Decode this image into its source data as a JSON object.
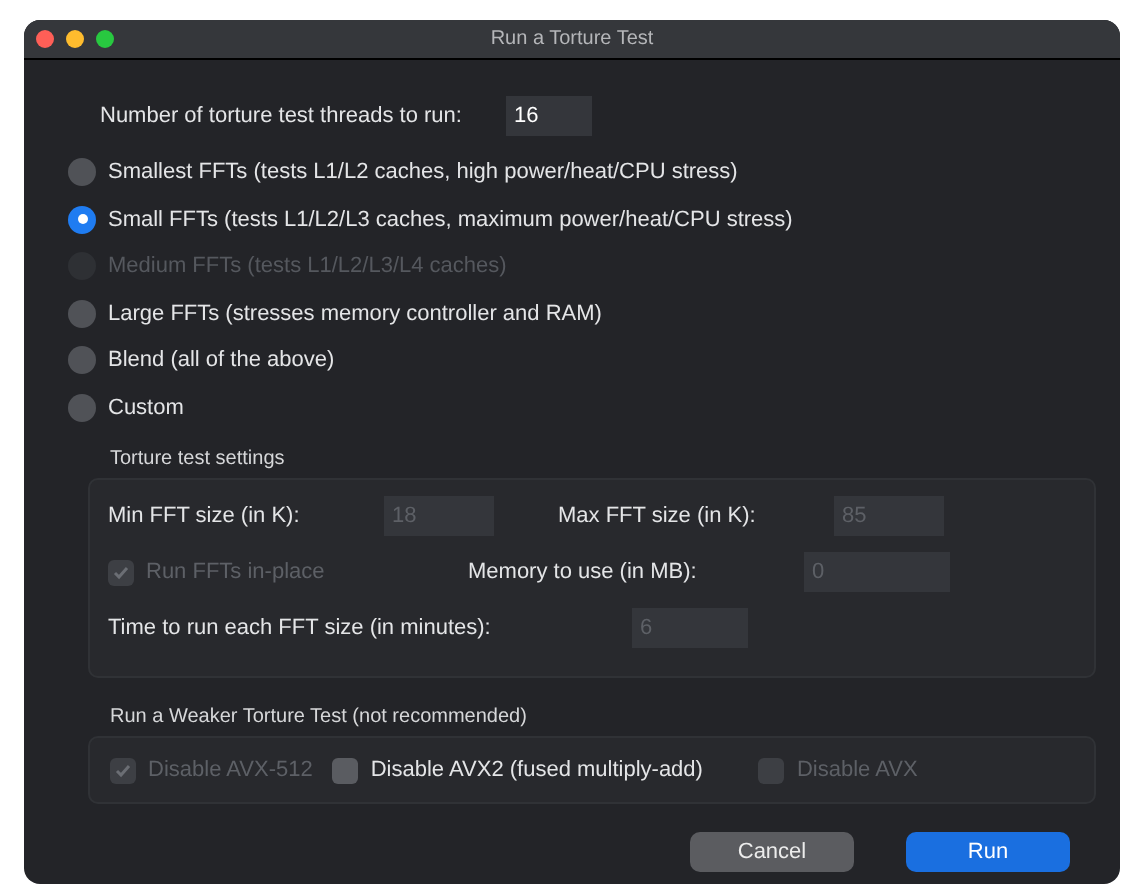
{
  "window": {
    "title": "Run a Torture Test"
  },
  "threads": {
    "label": "Number of torture test threads to run:",
    "value": "16"
  },
  "tests": [
    {
      "label": "Smallest FFTs (tests L1/L2 caches, high power/heat/CPU stress)",
      "selected": false,
      "disabled": false
    },
    {
      "label": "Small FFTs (tests L1/L2/L3 caches, maximum power/heat/CPU stress)",
      "selected": true,
      "disabled": false
    },
    {
      "label": "Medium FFTs (tests L1/L2/L3/L4 caches)",
      "selected": false,
      "disabled": true
    },
    {
      "label": "Large FFTs (stresses memory controller and RAM)",
      "selected": false,
      "disabled": false
    },
    {
      "label": "Blend (all of the above)",
      "selected": false,
      "disabled": false
    },
    {
      "label": "Custom",
      "selected": false,
      "disabled": false
    }
  ],
  "settings": {
    "title": "Torture test settings",
    "min_fft": {
      "label": "Min FFT size (in K):",
      "value": "18",
      "disabled": true
    },
    "max_fft": {
      "label": "Max FFT size (in K):",
      "value": "85",
      "disabled": true
    },
    "in_place": {
      "label": "Run FFTs in-place",
      "checked": true,
      "disabled": true
    },
    "memory": {
      "label": "Memory to use (in MB):",
      "value": "0",
      "disabled": true
    },
    "time": {
      "label": "Time to run each FFT size (in minutes):",
      "value": "6",
      "disabled": true
    }
  },
  "weaker": {
    "title": "Run a Weaker Torture Test (not recommended)",
    "options": [
      {
        "label": "Disable AVX-512",
        "checked": true,
        "disabled": true
      },
      {
        "label": "Disable AVX2 (fused multiply-add)",
        "checked": false,
        "disabled": false
      },
      {
        "label": "Disable AVX",
        "checked": false,
        "disabled": true
      }
    ]
  },
  "buttons": [
    {
      "label": "Cancel",
      "kind": "secondary"
    },
    {
      "label": "Run",
      "kind": "primary"
    }
  ]
}
